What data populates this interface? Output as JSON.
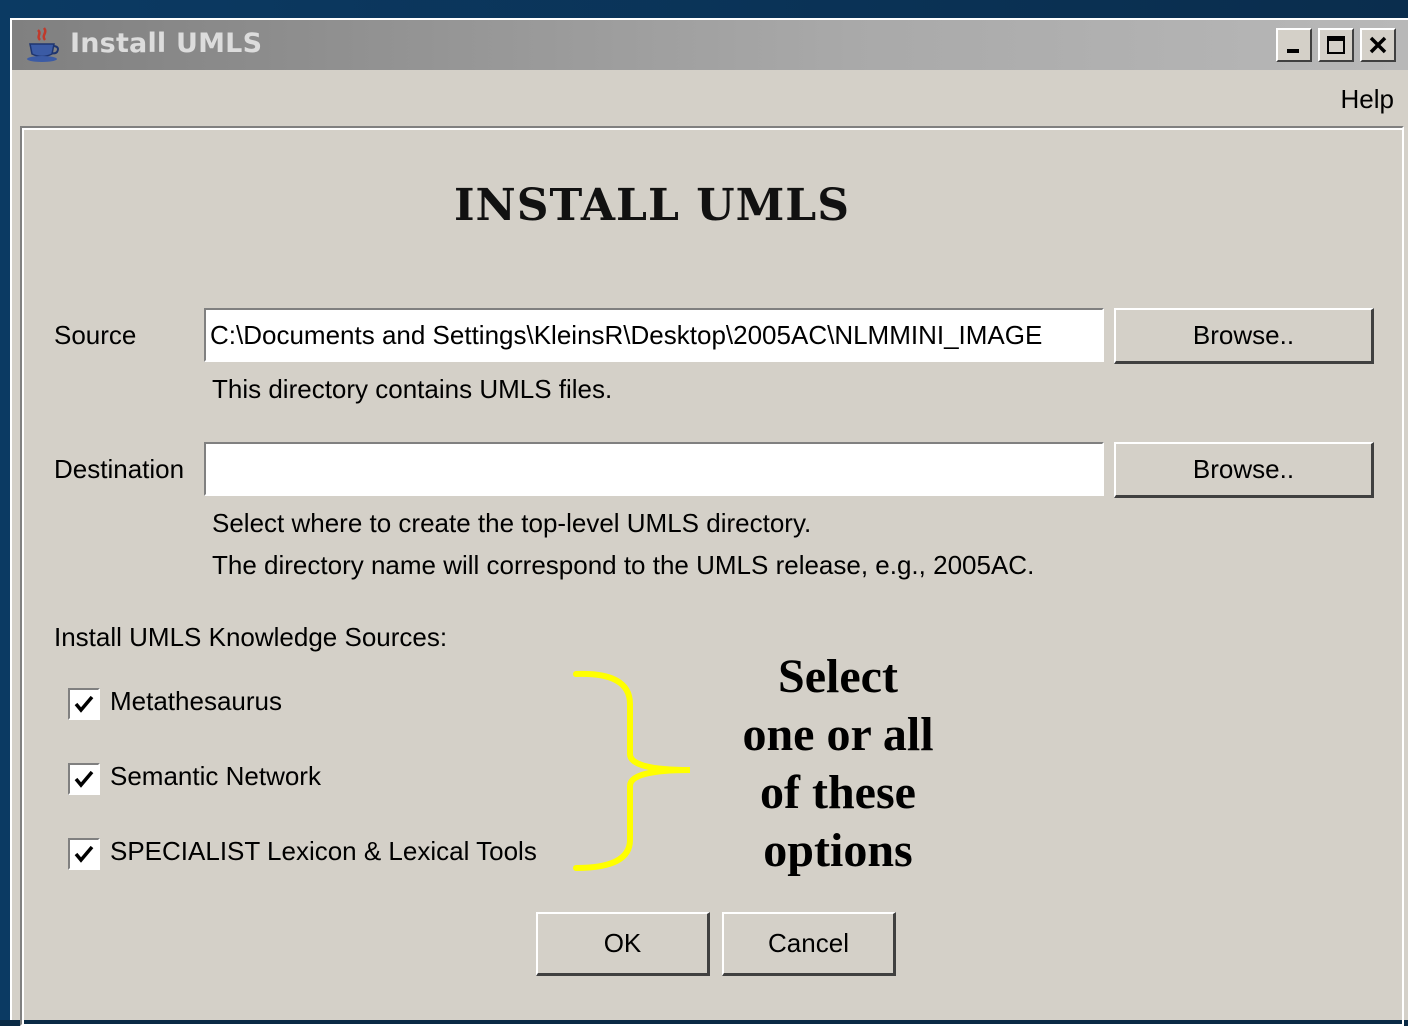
{
  "window": {
    "title": "Install UMLS",
    "icon": "java-coffee-cup-icon",
    "controls": {
      "minimize": "minimize-icon",
      "maximize": "maximize-icon",
      "close": "close-icon"
    }
  },
  "menubar": {
    "help": "Help"
  },
  "main": {
    "heading": "INSTALL UMLS",
    "source": {
      "label": "Source",
      "value": "C:\\Documents and Settings\\KleinsR\\Desktop\\2005AC\\NLMMINI_IMAGE",
      "browse_label": "Browse..",
      "hint": "This directory contains UMLS files."
    },
    "destination": {
      "label": "Destination",
      "value": "",
      "browse_label": "Browse..",
      "hint_line1": "Select where to create the top-level UMLS directory.",
      "hint_line2": "The directory name will correspond to the UMLS release, e.g.,  2005AC."
    },
    "knowledge_sources": {
      "label": "Install UMLS Knowledge Sources:",
      "options": [
        {
          "label": "Metathesaurus",
          "checked": true
        },
        {
          "label": "Semantic Network",
          "checked": true
        },
        {
          "label": "SPECIALIST Lexicon & Lexical Tools",
          "checked": true
        }
      ]
    },
    "annotation": {
      "line1": "Select",
      "line2": "one or all",
      "line3": "of these",
      "line4": "options",
      "brace_color": "#ffff00"
    },
    "buttons": {
      "ok": "OK",
      "cancel": "Cancel"
    }
  },
  "colors": {
    "dialog_bg": "#d4d0c8",
    "titlebar_inactive": "#a9a9a9",
    "desktop": "#0b3a63"
  }
}
